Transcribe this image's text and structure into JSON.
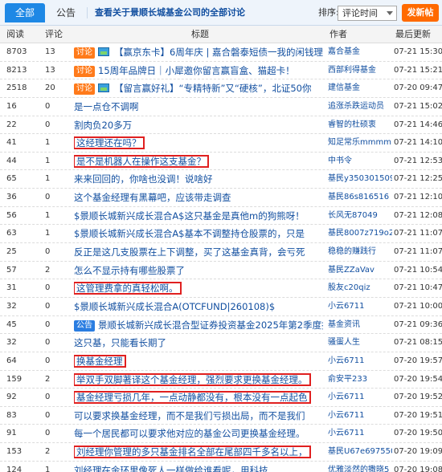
{
  "tabs": {
    "all": "全部",
    "notice": "公告"
  },
  "discuss_link": "查看关于景顺长城基金公司的全部讨论",
  "sort": {
    "label": "排序:",
    "selected": "评论时间"
  },
  "post_button": "发新帖",
  "columns": {
    "read": "阅读",
    "comment": "评论",
    "title": "标题",
    "author": "作者",
    "updated": "最后更新"
  },
  "rows": [
    {
      "read": "8703",
      "comment": "13",
      "badge": "讨论",
      "img": true,
      "title": "【赢京东卡】6周年庆 | 嘉合磐泰短债一我的闲钱理",
      "author": "嘉合基金",
      "time": "07-21 15:30"
    },
    {
      "read": "8213",
      "comment": "13",
      "badge": "讨论",
      "img": false,
      "title": "15周年品牌日｜小犀邀你留言赢盲盒、猫超卡！",
      "author": "西部利得基金",
      "time": "07-21 15:21"
    },
    {
      "read": "2518",
      "comment": "20",
      "badge": "讨论",
      "img": true,
      "title": "【留言赢好礼】“专精特新”又“硬核”，北证50你",
      "author": "建信基金",
      "time": "07-20 09:47"
    },
    {
      "read": "16",
      "comment": "0",
      "badge": "",
      "img": false,
      "title": "是一点仓不调啊",
      "author": "追涨杀跌运动员",
      "time": "07-21 15:02"
    },
    {
      "read": "22",
      "comment": "0",
      "badge": "",
      "img": false,
      "title": "割肉负20多万",
      "author": "睿智的杜硕衷",
      "time": "07-21 14:46"
    },
    {
      "read": "41",
      "comment": "1",
      "badge": "",
      "img": false,
      "title": "这经理还在吗？",
      "author": "知足常乐mmmm",
      "time": "07-21 14:10",
      "hl": true
    },
    {
      "read": "44",
      "comment": "1",
      "badge": "",
      "img": false,
      "title": "是不是机器人在操作这支基金？",
      "author": "中书令",
      "time": "07-21 12:53",
      "hl": true
    },
    {
      "read": "65",
      "comment": "1",
      "badge": "",
      "img": false,
      "title": "来来回回的，你啥也没调！说啥好",
      "author": "基民y350301509",
      "time": "07-21 12:25"
    },
    {
      "read": "36",
      "comment": "0",
      "badge": "",
      "img": false,
      "title": "这个基金经理有黑幕吧，应该带走调查",
      "author": "基民86s816516",
      "time": "07-21 12:10"
    },
    {
      "read": "56",
      "comment": "1",
      "badge": "",
      "img": false,
      "title": "$景顺长城新兴成长混合A$这只基金是真他m的狗熊呀！",
      "author": "长风无87049",
      "time": "07-21 12:08"
    },
    {
      "read": "63",
      "comment": "1",
      "badge": "",
      "img": false,
      "title": "$景顺长城新兴成长混合A$基本不调整持仓股票的，只是",
      "author": "基民8007z719o2",
      "time": "07-21 11:07"
    },
    {
      "read": "25",
      "comment": "0",
      "badge": "",
      "img": false,
      "title": "反正是这几支股票在上下调整，买了这基金真背，会亏死",
      "author": "稳稳的赚践行",
      "time": "07-21 11:07"
    },
    {
      "read": "57",
      "comment": "2",
      "badge": "",
      "img": false,
      "title": "怎么不显示持有哪些股票了",
      "author": "基民ZZaVav",
      "time": "07-21 10:54"
    },
    {
      "read": "31",
      "comment": "0",
      "badge": "",
      "img": false,
      "title": "这管理费拿的真轻松啊。",
      "author": "股友c20qiz",
      "time": "07-21 10:47",
      "hl": true
    },
    {
      "read": "32",
      "comment": "0",
      "badge": "",
      "img": false,
      "title": "$景顺长城新兴成长混合A(OTCFUND|260108)$",
      "author": "小云6711",
      "time": "07-21 10:00"
    },
    {
      "read": "45",
      "comment": "0",
      "badge": "公告",
      "badgeBlue": true,
      "img": false,
      "title": "景顺长城新兴成长混合型证券投资基金2025年第2季度报",
      "author": "基金资讯",
      "time": "07-21 09:36"
    },
    {
      "read": "32",
      "comment": "0",
      "badge": "",
      "img": false,
      "title": "这只基，只能看长期了",
      "author": "骚蛋人生",
      "time": "07-21 08:15"
    },
    {
      "read": "64",
      "comment": "0",
      "badge": "",
      "img": false,
      "title": "换基金经理",
      "author": "小云6711",
      "time": "07-20 19:57",
      "hl": true
    },
    {
      "read": "159",
      "comment": "2",
      "badge": "",
      "img": false,
      "title": "举双手双脚著译这个基金经理，强烈要求更换基金经理。",
      "author": "俞安平233",
      "time": "07-20 19:54",
      "hl": true
    },
    {
      "read": "92",
      "comment": "0",
      "badge": "",
      "img": false,
      "title": "基金经理亏损几年，一点动静都没有，根本没有一点起色",
      "author": "小云6711",
      "time": "07-20 19:52",
      "hl": true
    },
    {
      "read": "83",
      "comment": "0",
      "badge": "",
      "img": false,
      "title": "可以要求换基金经理，而不是我们亏损出局，而不是我们",
      "author": "小云6711",
      "time": "07-20 19:51"
    },
    {
      "read": "91",
      "comment": "0",
      "badge": "",
      "img": false,
      "title": "每一个居民都可以要求他对应的基金公司更换基金经理。",
      "author": "小云6711",
      "time": "07-20 19:50"
    },
    {
      "read": "153",
      "comment": "2",
      "badge": "",
      "img": false,
      "title": "刘经理你管理的多只基金排名全部在尾部四千多名以上，",
      "author": "基民U67e697550",
      "time": "07-20 19:09",
      "hl": true
    },
    {
      "read": "124",
      "comment": "1",
      "badge": "",
      "img": false,
      "title": "刘经理在金环里像死人一样做给谁看呢，用科技",
      "author": "优雅淡然的撒晓5",
      "time": "07-20 19:08"
    }
  ]
}
